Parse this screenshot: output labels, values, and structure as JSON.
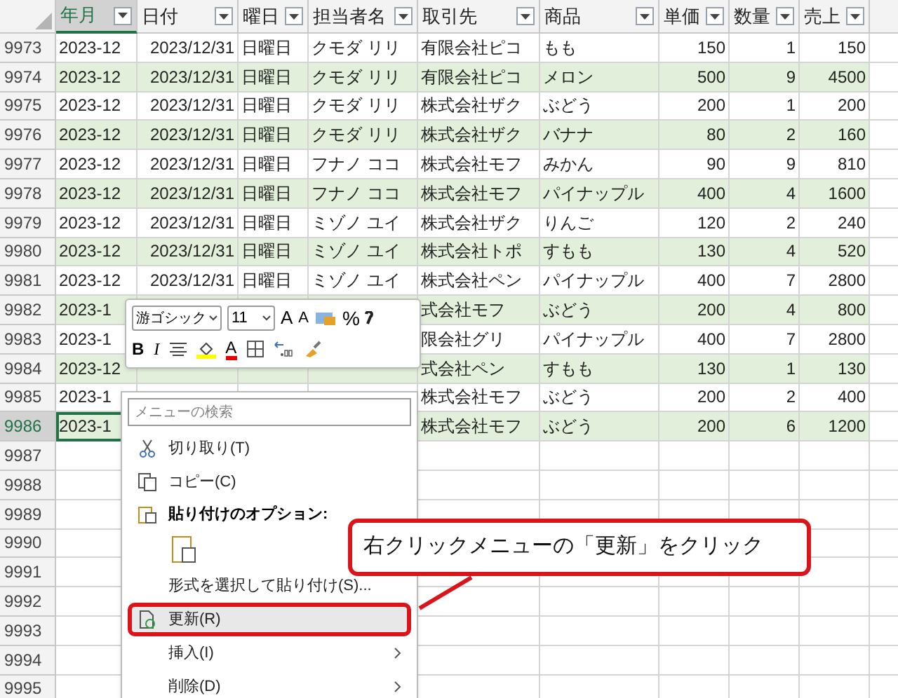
{
  "table": {
    "columns": [
      {
        "label": "年月",
        "selected": true
      },
      {
        "label": "日付",
        "selected": false
      },
      {
        "label": "曜日",
        "selected": false
      },
      {
        "label": "担当者名",
        "selected": false
      },
      {
        "label": "取引先",
        "selected": false
      },
      {
        "label": "商品",
        "selected": false
      },
      {
        "label": "単価",
        "selected": false
      },
      {
        "label": "数量",
        "selected": false
      },
      {
        "label": "売上",
        "selected": false
      }
    ],
    "rows": [
      {
        "num": "9973",
        "selected": false,
        "cells": [
          "2023-12",
          "2023/12/31",
          "日曜日",
          "クモダ リリ",
          "有限会社ピコ",
          "もも",
          "150",
          "1",
          "150"
        ]
      },
      {
        "num": "9974",
        "selected": false,
        "cells": [
          "2023-12",
          "2023/12/31",
          "日曜日",
          "クモダ リリ",
          "有限会社ピコ",
          "メロン",
          "500",
          "9",
          "4500"
        ]
      },
      {
        "num": "9975",
        "selected": false,
        "cells": [
          "2023-12",
          "2023/12/31",
          "日曜日",
          "クモダ リリ",
          "株式会社ザク",
          "ぶどう",
          "200",
          "1",
          "200"
        ]
      },
      {
        "num": "9976",
        "selected": false,
        "cells": [
          "2023-12",
          "2023/12/31",
          "日曜日",
          "クモダ リリ",
          "株式会社ザク",
          "バナナ",
          "80",
          "2",
          "160"
        ]
      },
      {
        "num": "9977",
        "selected": false,
        "cells": [
          "2023-12",
          "2023/12/31",
          "日曜日",
          "フナノ ココ",
          "株式会社モフ",
          "みかん",
          "90",
          "9",
          "810"
        ]
      },
      {
        "num": "9978",
        "selected": false,
        "cells": [
          "2023-12",
          "2023/12/31",
          "日曜日",
          "フナノ ココ",
          "株式会社モフ",
          "パイナップル",
          "400",
          "4",
          "1600"
        ]
      },
      {
        "num": "9979",
        "selected": false,
        "cells": [
          "2023-12",
          "2023/12/31",
          "日曜日",
          "ミゾノ ユイ",
          "株式会社ザク",
          "りんご",
          "120",
          "2",
          "240"
        ]
      },
      {
        "num": "9980",
        "selected": false,
        "cells": [
          "2023-12",
          "2023/12/31",
          "日曜日",
          "ミゾノ ユイ",
          "株式会社トポ",
          "すもも",
          "130",
          "4",
          "520"
        ]
      },
      {
        "num": "9981",
        "selected": false,
        "cells": [
          "2023-12",
          "2023/12/31",
          "日曜日",
          "ミゾノ ユイ",
          "株式会社ペン",
          "パイナップル",
          "400",
          "7",
          "2800"
        ]
      },
      {
        "num": "9982",
        "selected": false,
        "cells": [
          "2023-1",
          null,
          null,
          null,
          "式会社モフ",
          "ぶどう",
          "200",
          "4",
          "800"
        ]
      },
      {
        "num": "9983",
        "selected": false,
        "cells": [
          "2023-1",
          null,
          null,
          null,
          "限会社グリ",
          "パイナップル",
          "400",
          "7",
          "2800"
        ]
      },
      {
        "num": "9984",
        "selected": false,
        "cells": [
          "2023-12",
          null,
          null,
          null,
          "式会社ペン",
          "すもも",
          "130",
          "1",
          "130"
        ]
      },
      {
        "num": "9985",
        "selected": false,
        "cells": [
          "2023-1",
          null,
          null,
          null,
          "株式会社モフ",
          "ぶどう",
          "200",
          "2",
          "400"
        ]
      },
      {
        "num": "9986",
        "selected": true,
        "cells": [
          "2023-1",
          null,
          null,
          null,
          "株式会社モフ",
          "ぶどう",
          "200",
          "6",
          "1200"
        ]
      },
      {
        "num": "9987",
        "selected": false
      },
      {
        "num": "9988",
        "selected": false
      },
      {
        "num": "9989",
        "selected": false
      },
      {
        "num": "9990",
        "selected": false
      },
      {
        "num": "9991",
        "selected": false
      },
      {
        "num": "9992",
        "selected": false
      },
      {
        "num": "9993",
        "selected": false
      },
      {
        "num": "9994",
        "selected": false
      },
      {
        "num": "9995",
        "selected": false
      }
    ]
  },
  "mini_toolbar": {
    "font": "游ゴシック",
    "size": "11",
    "grow": "A",
    "shrink": "A",
    "percent": "%",
    "bold": "B",
    "italic": "I",
    "font_color": "A"
  },
  "context_menu": {
    "search": {
      "placeholder": "メニューの検索"
    },
    "items": [
      {
        "kind": "item",
        "label": "切り取り(T)",
        "highlighted": false
      },
      {
        "kind": "item",
        "label": "コピー(C)",
        "highlighted": false
      },
      {
        "kind": "heading",
        "label": "貼り付けのオプション:",
        "highlighted": false
      },
      {
        "kind": "paste",
        "highlighted": false
      },
      {
        "kind": "item",
        "label": "形式を選択して貼り付け(S)...",
        "highlighted": false
      },
      {
        "kind": "item",
        "label": "更新(R)",
        "highlighted": true
      },
      {
        "kind": "submenu",
        "label": "挿入(I)",
        "highlighted": false
      },
      {
        "kind": "submenu",
        "label": "削除(D)",
        "highlighted": false
      }
    ]
  },
  "callout": {
    "text": "右クリックメニューの「更新」をクリック"
  }
}
